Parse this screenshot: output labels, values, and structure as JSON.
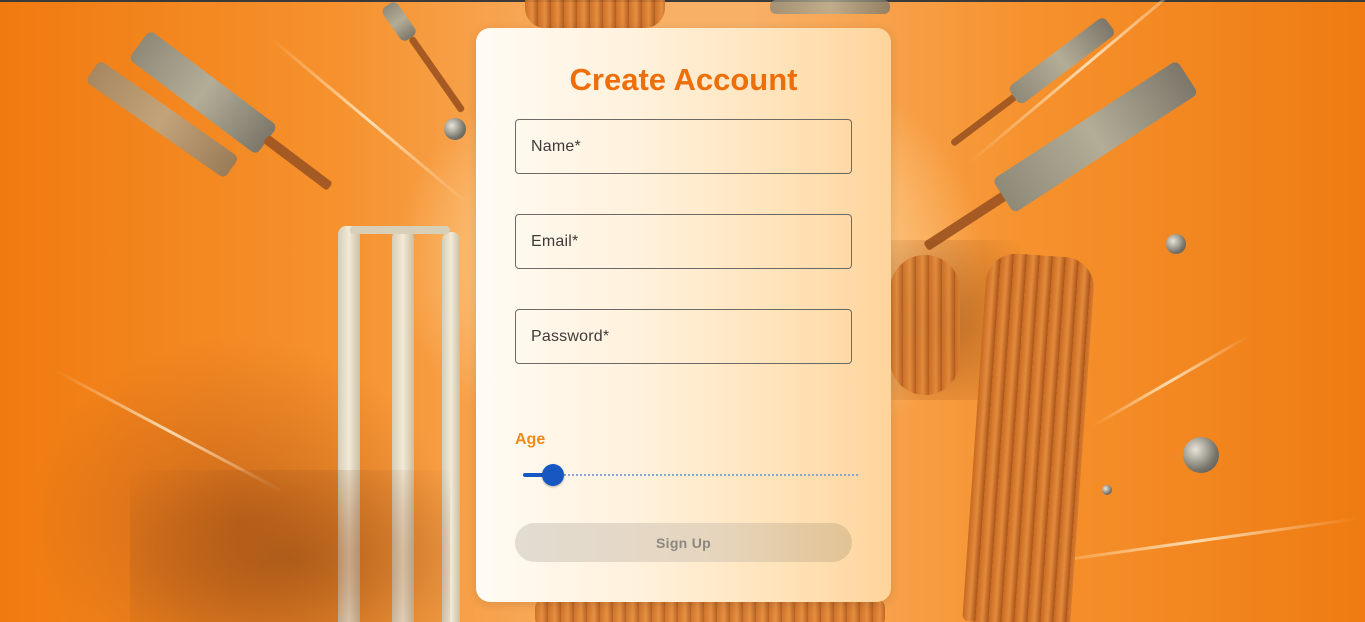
{
  "form": {
    "title": "Create Account",
    "fields": {
      "name": {
        "placeholder": "Name*",
        "value": ""
      },
      "email": {
        "placeholder": "Email*",
        "value": ""
      },
      "password": {
        "placeholder": "Password*",
        "value": ""
      }
    },
    "age": {
      "label": "Age",
      "slider_fraction": 0.09
    },
    "submit_label": "Sign Up"
  },
  "colors": {
    "accent": "#ee6e0a",
    "slider": "#1757c2",
    "background": "#f6922e"
  },
  "background_image": {
    "icons": [
      "cricket-bat-icon",
      "cricket-stumps-icon",
      "cricket-ball-icon",
      "batting-pad-icon"
    ]
  }
}
